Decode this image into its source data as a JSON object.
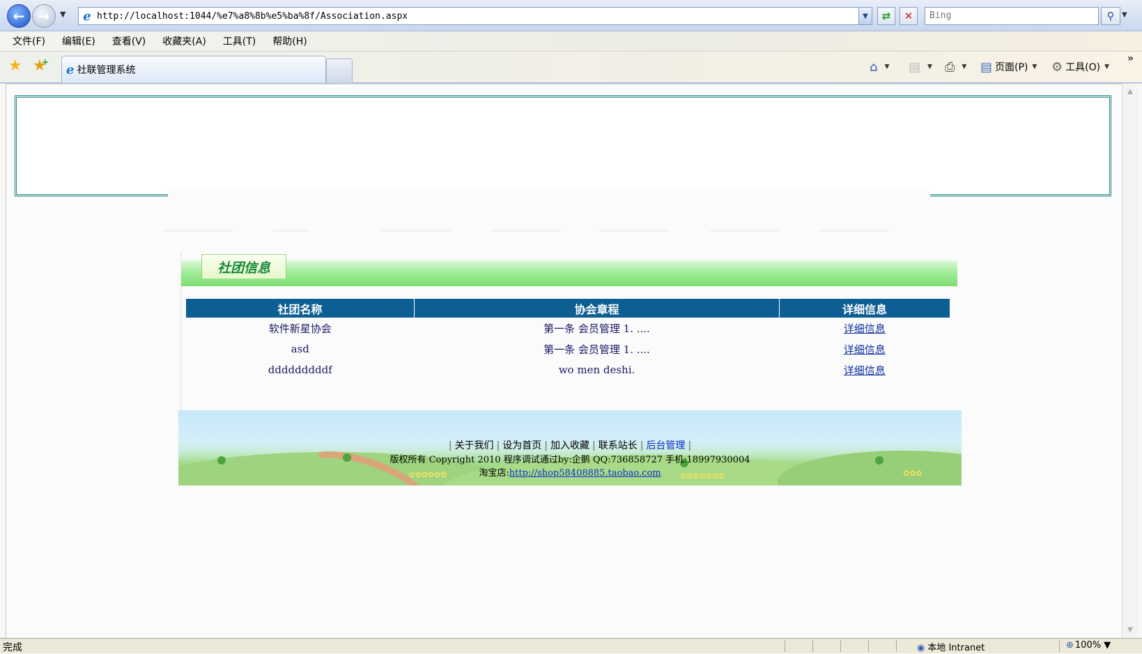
{
  "browser": {
    "url": "http://localhost:1044/%e7%a8%8b%e5%ba%8f/Association.aspx",
    "search_placeholder": "Bing",
    "menu": [
      "文件(F)",
      "编辑(E)",
      "查看(V)",
      "收藏夹(A)",
      "工具(T)",
      "帮助(H)"
    ],
    "tab_title": "社联管理系统",
    "commands": {
      "page": "页面(P)",
      "tools": "工具(O)"
    }
  },
  "section": {
    "title": "社团信息"
  },
  "table": {
    "headers": [
      "社团名称",
      "协会章程",
      "详细信息"
    ],
    "rows": [
      {
        "name": "软件新星协会",
        "charter": "第一条  会员管理  1. ....",
        "detail": "详细信息"
      },
      {
        "name": "asd",
        "charter": "第一条  会员管理  1. ....",
        "detail": "详细信息"
      },
      {
        "name": "dddddddddf",
        "charter": "wo men deshi.",
        "detail": "详细信息"
      }
    ]
  },
  "footer": {
    "links": [
      "关于我们",
      "设为首页",
      "加入收藏",
      "联系站长",
      "后台管理"
    ],
    "copyright": "版权所有  Copyright 2010 程序调试通过by:企鹅  QQ:736858727 手机:18997930004",
    "shop_label": "淘宝店:",
    "shop_url": "http://shop58408885.taobao.com"
  },
  "status": {
    "text": "完成",
    "zone": "本地 Intranet",
    "zoom": "100%"
  }
}
